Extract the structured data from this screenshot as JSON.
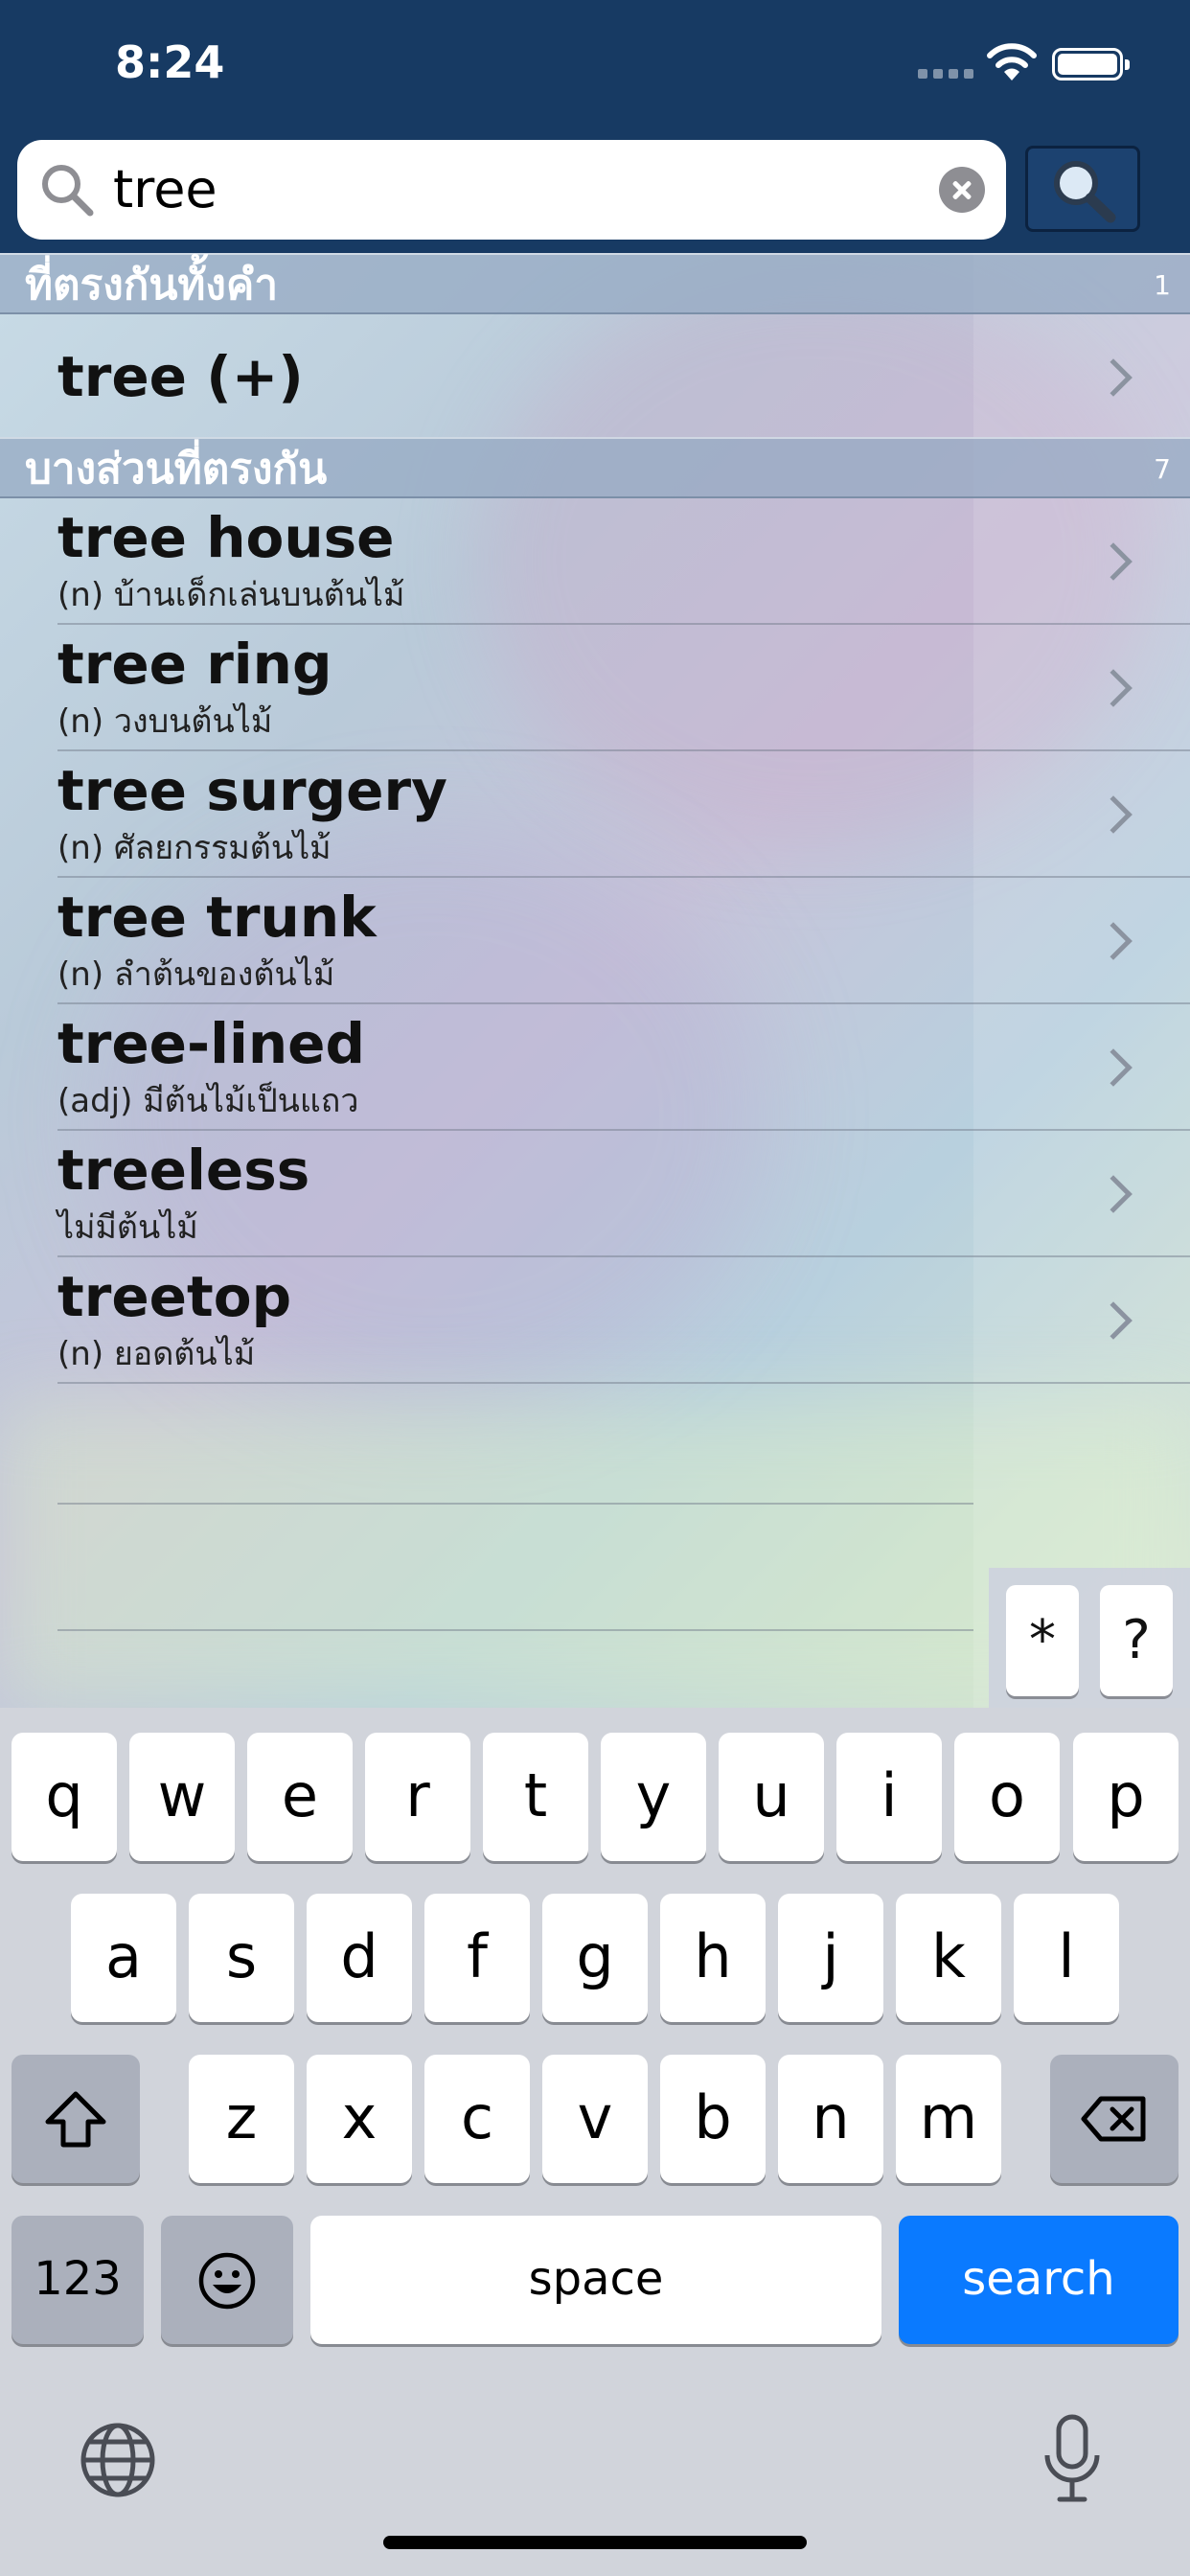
{
  "status": {
    "time": "8:24"
  },
  "search": {
    "query": "tree"
  },
  "sections": [
    {
      "title": "ที่ตรงกันทั้งคำ",
      "count": "1"
    },
    {
      "title": "บางส่วนที่ตรงกัน",
      "count": "7"
    }
  ],
  "exact_results": [
    {
      "word": "tree (+)"
    }
  ],
  "partial_results": [
    {
      "word": "tree house",
      "definition": "(n) บ้านเด็กเล่นบนต้นไม้"
    },
    {
      "word": "tree ring",
      "definition": "(n) วงบนต้นไม้"
    },
    {
      "word": "tree surgery",
      "definition": "(n) ศัลยกรรมต้นไม้"
    },
    {
      "word": "tree trunk",
      "definition": "(n) ลำต้นของต้นไม้"
    },
    {
      "word": "tree-lined",
      "definition": "(adj) มีต้นไม้เป็นแถว"
    },
    {
      "word": "treeless",
      "definition": "ไม่มีต้นไม้"
    },
    {
      "word": "treetop",
      "definition": "(n) ยอดต้นไม้"
    }
  ],
  "special_keys": [
    "*",
    "?"
  ],
  "keyboard": {
    "row1": [
      "q",
      "w",
      "e",
      "r",
      "t",
      "y",
      "u",
      "i",
      "o",
      "p"
    ],
    "row2": [
      "a",
      "s",
      "d",
      "f",
      "g",
      "h",
      "j",
      "k",
      "l"
    ],
    "row3": [
      "z",
      "x",
      "c",
      "v",
      "b",
      "n",
      "m"
    ],
    "numbers": "123",
    "space": "space",
    "search": "search"
  },
  "colors": {
    "navbar": "#173a63",
    "accent": "#0a7aff"
  }
}
